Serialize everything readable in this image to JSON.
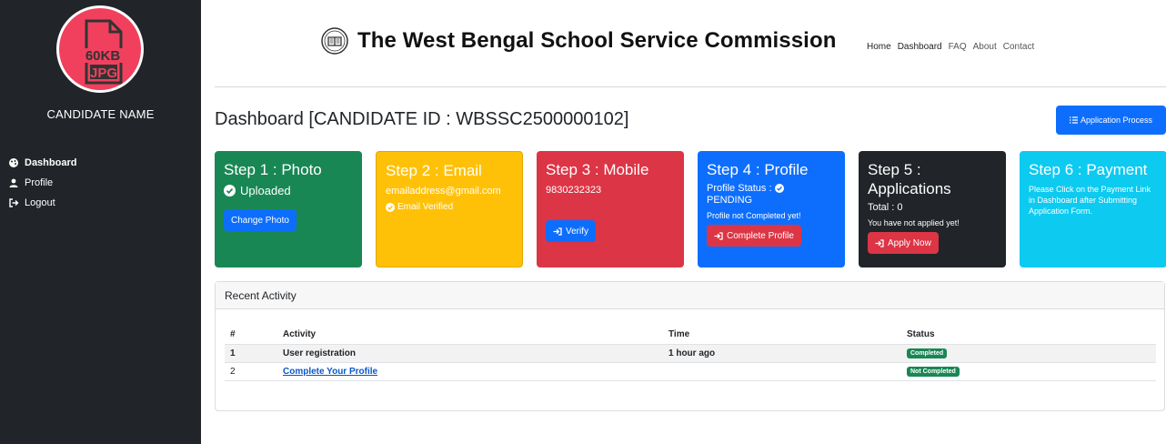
{
  "sidebar": {
    "avatar": {
      "size_text": "60KB",
      "type_text": "JPG"
    },
    "candidate_name": "CANDIDATE NAME",
    "items": [
      {
        "label": "Dashboard",
        "icon": "palette-icon",
        "active": true
      },
      {
        "label": "Profile",
        "icon": "user-icon",
        "active": false
      },
      {
        "label": "Logout",
        "icon": "logout-icon",
        "active": false
      }
    ]
  },
  "header": {
    "title": "The West Bengal School Service Commission",
    "nav": [
      "Home",
      "Dashboard",
      "FAQ",
      "About",
      "Contact"
    ]
  },
  "dashboard": {
    "title": "Dashboard [CANDIDATE ID : WBSSC2500000102]",
    "process_button": "Application Process"
  },
  "steps": [
    {
      "title": "Step 1 : Photo",
      "status": "Uploaded",
      "button": "Change Photo",
      "color": "#198754"
    },
    {
      "title": "Step 2 : Email",
      "email": "emailaddress@gmail.com",
      "verified": "Email Verified",
      "color": "#ffc107"
    },
    {
      "title": "Step 3 : Mobile",
      "mobile": "9830232323",
      "button": "Verify",
      "color": "#dc3545"
    },
    {
      "title": "Step 4 : Profile",
      "status_label": "Profile Status :",
      "status_value": "PENDING",
      "note": "Profile not Completed yet!",
      "button": "Complete Profile",
      "color": "#0d6efd"
    },
    {
      "title_line1": "Step 5 :",
      "title_line2": "Applications",
      "total": "Total : 0",
      "note": "You have not applied yet!",
      "button": "Apply Now",
      "color": "#212529"
    },
    {
      "title": "Step 6 : Payment",
      "note": "Please Click on the Payment Link in Dashboard after Submitting Application Form.",
      "color": "#0dcaf0"
    }
  ],
  "activity": {
    "heading": "Recent Activity",
    "columns": [
      "#",
      "Activity",
      "Time",
      "Status"
    ],
    "rows": [
      {
        "num": "1",
        "activity": "User registration",
        "time": "1 hour ago",
        "status": "Completed"
      },
      {
        "num": "2",
        "activity": "Complete Your Profile",
        "time": "",
        "status": "Not Completed"
      }
    ]
  }
}
